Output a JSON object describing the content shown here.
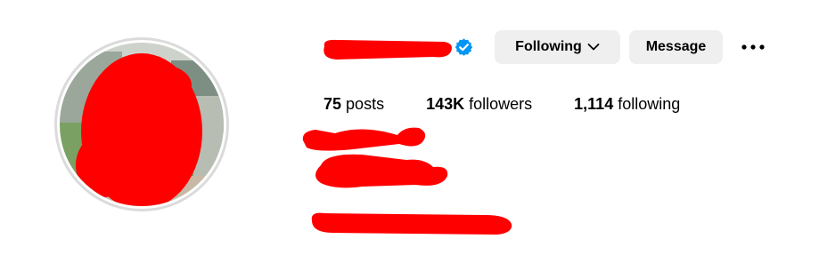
{
  "profile": {
    "verified_icon": "verified-badge-icon",
    "accent_color": "#0095f6",
    "redaction_color": "#ff0000"
  },
  "actions": {
    "following_label": "Following",
    "following_icon": "chevron-down-icon",
    "message_label": "Message",
    "more_icon": "more-horizontal-icon"
  },
  "stats": {
    "posts_count": "75",
    "posts_label": "posts",
    "followers_count": "143K",
    "followers_label": "followers",
    "following_count": "1,114",
    "following_label": "following"
  }
}
